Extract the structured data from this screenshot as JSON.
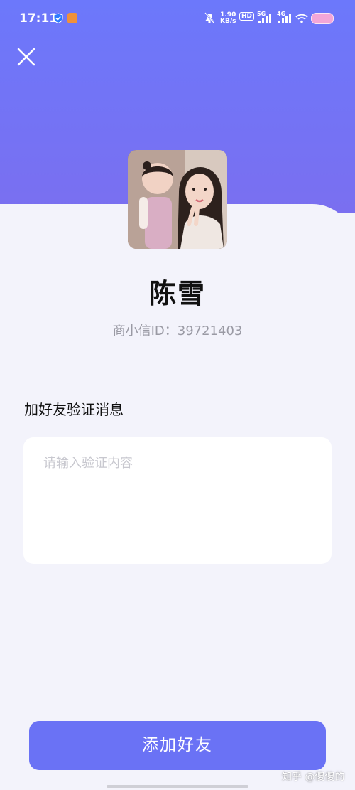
{
  "status_bar": {
    "time": "17:11",
    "net_speed_value": "1.90",
    "net_speed_unit": "KB/s",
    "hd_label": "HD",
    "signal_1_label": "5G",
    "signal_2_label": "4G",
    "icons": [
      "shield-app-icon",
      "video-app-icon",
      "mute-icon",
      "hd-icon",
      "signal-5g-icon",
      "signal-4g-icon",
      "wifi-icon",
      "battery-icon"
    ]
  },
  "header": {
    "close_icon": "close-icon",
    "gradient_color": "#6c78fb"
  },
  "profile": {
    "name": "陈雪",
    "id_text": "商小信ID：39721403"
  },
  "verification": {
    "title": "加好友验证消息",
    "placeholder": "请输入验证内容",
    "value": ""
  },
  "actions": {
    "add_friend_label": "添加好友",
    "button_color": "#6a72f5"
  },
  "watermark": "知乎 @傻傻的"
}
